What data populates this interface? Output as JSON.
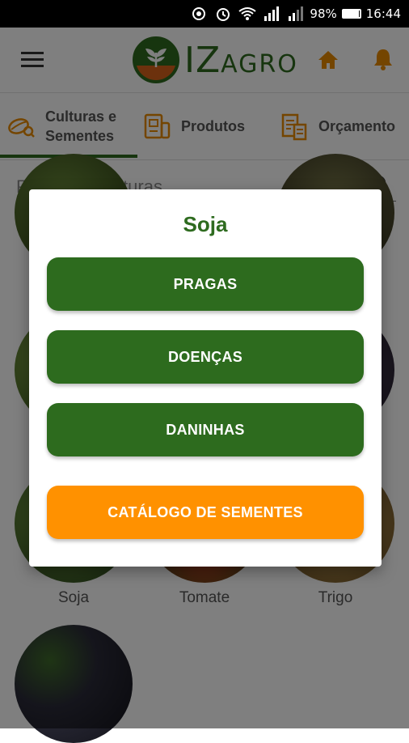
{
  "status_bar": {
    "battery": "98%",
    "time": "16:44",
    "battery_level": 0.98
  },
  "header": {
    "logo_text": "IZ",
    "logo_subtext": "AGRO",
    "icons": [
      "menu-icon",
      "home-icon",
      "bell-icon"
    ]
  },
  "tabs": [
    {
      "label_line1": "Culturas e",
      "label_line2": "Sementes",
      "icon": "seed-icon",
      "active": true
    },
    {
      "label": "Produtos",
      "icon": "products-icon",
      "active": false
    },
    {
      "label": "Orçamento",
      "icon": "budget-icon",
      "active": false
    }
  ],
  "search": {
    "placeholder": "Pesquisar culturas"
  },
  "crops": [
    {
      "label": "Soja"
    },
    {
      "label": "Tomate"
    },
    {
      "label": "Trigo"
    },
    {
      "label": ""
    }
  ],
  "dialog": {
    "title": "Soja",
    "buttons": [
      {
        "label": "PRAGAS"
      },
      {
        "label": "DOENÇAS"
      },
      {
        "label": "DANINHAS"
      },
      {
        "label": "CATÁLOGO DE SEMENTES"
      }
    ]
  },
  "colors": {
    "primary_green": "#2d6b1e",
    "accent_orange": "#ff9100",
    "icon_orange": "#e88a00"
  }
}
